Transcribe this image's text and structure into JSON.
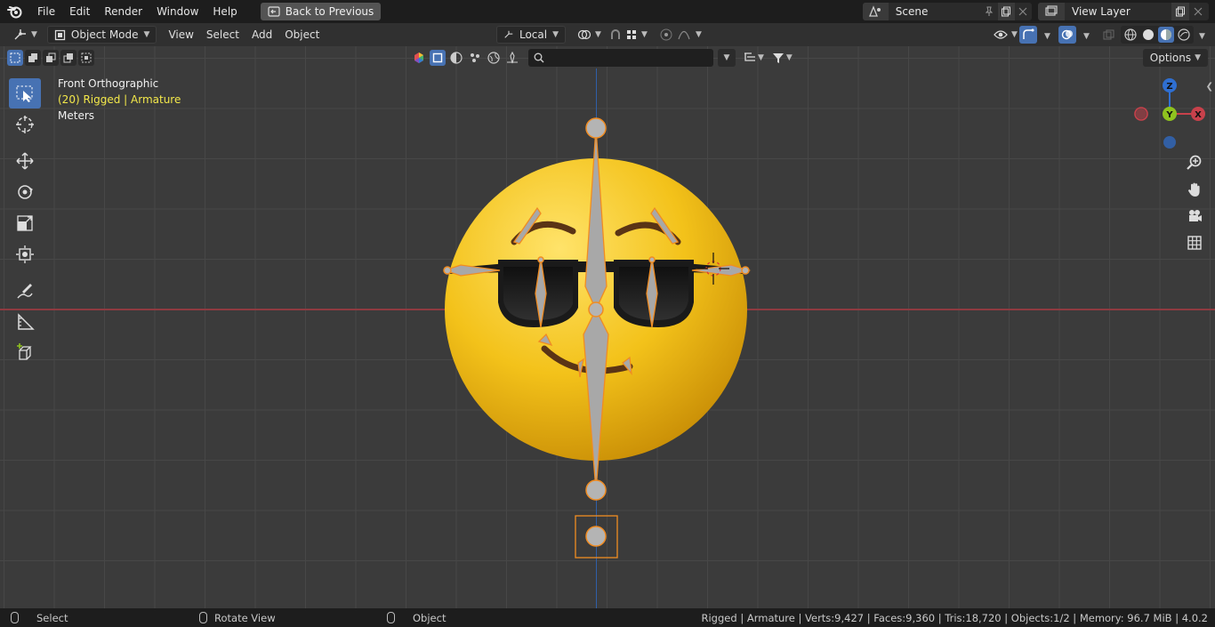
{
  "menu": {
    "items": [
      "File",
      "Edit",
      "Render",
      "Window",
      "Help"
    ],
    "back_button": "Back to Previous"
  },
  "scene": {
    "label": "Scene"
  },
  "view_layer": {
    "label": "View Layer"
  },
  "header": {
    "mode": "Object Mode",
    "menus": [
      "View",
      "Select",
      "Add",
      "Object"
    ],
    "transform_orientation": "Local"
  },
  "viewport": {
    "view_name": "Front Orthographic",
    "object_info": "(20) Rigged | Armature",
    "units": "Meters",
    "options_label": "Options",
    "search_placeholder": ""
  },
  "gizmo": {
    "z": "Z",
    "y": "Y",
    "x": "X"
  },
  "colors": {
    "accent": "#4772b3",
    "x_axis": "#c8414b",
    "y_axis": "#8fc21f",
    "z_axis": "#2f6fd1",
    "selection": "#f08c22",
    "object_info_text": "#f3e84a"
  },
  "status": {
    "left": "Select",
    "middle": "Rotate View",
    "right": "Object",
    "stats": "Rigged | Armature | Verts:9,427 | Faces:9,360 | Tris:18,720 | Objects:1/2 | Memory: 96.7 MiB | 4.0.2"
  }
}
